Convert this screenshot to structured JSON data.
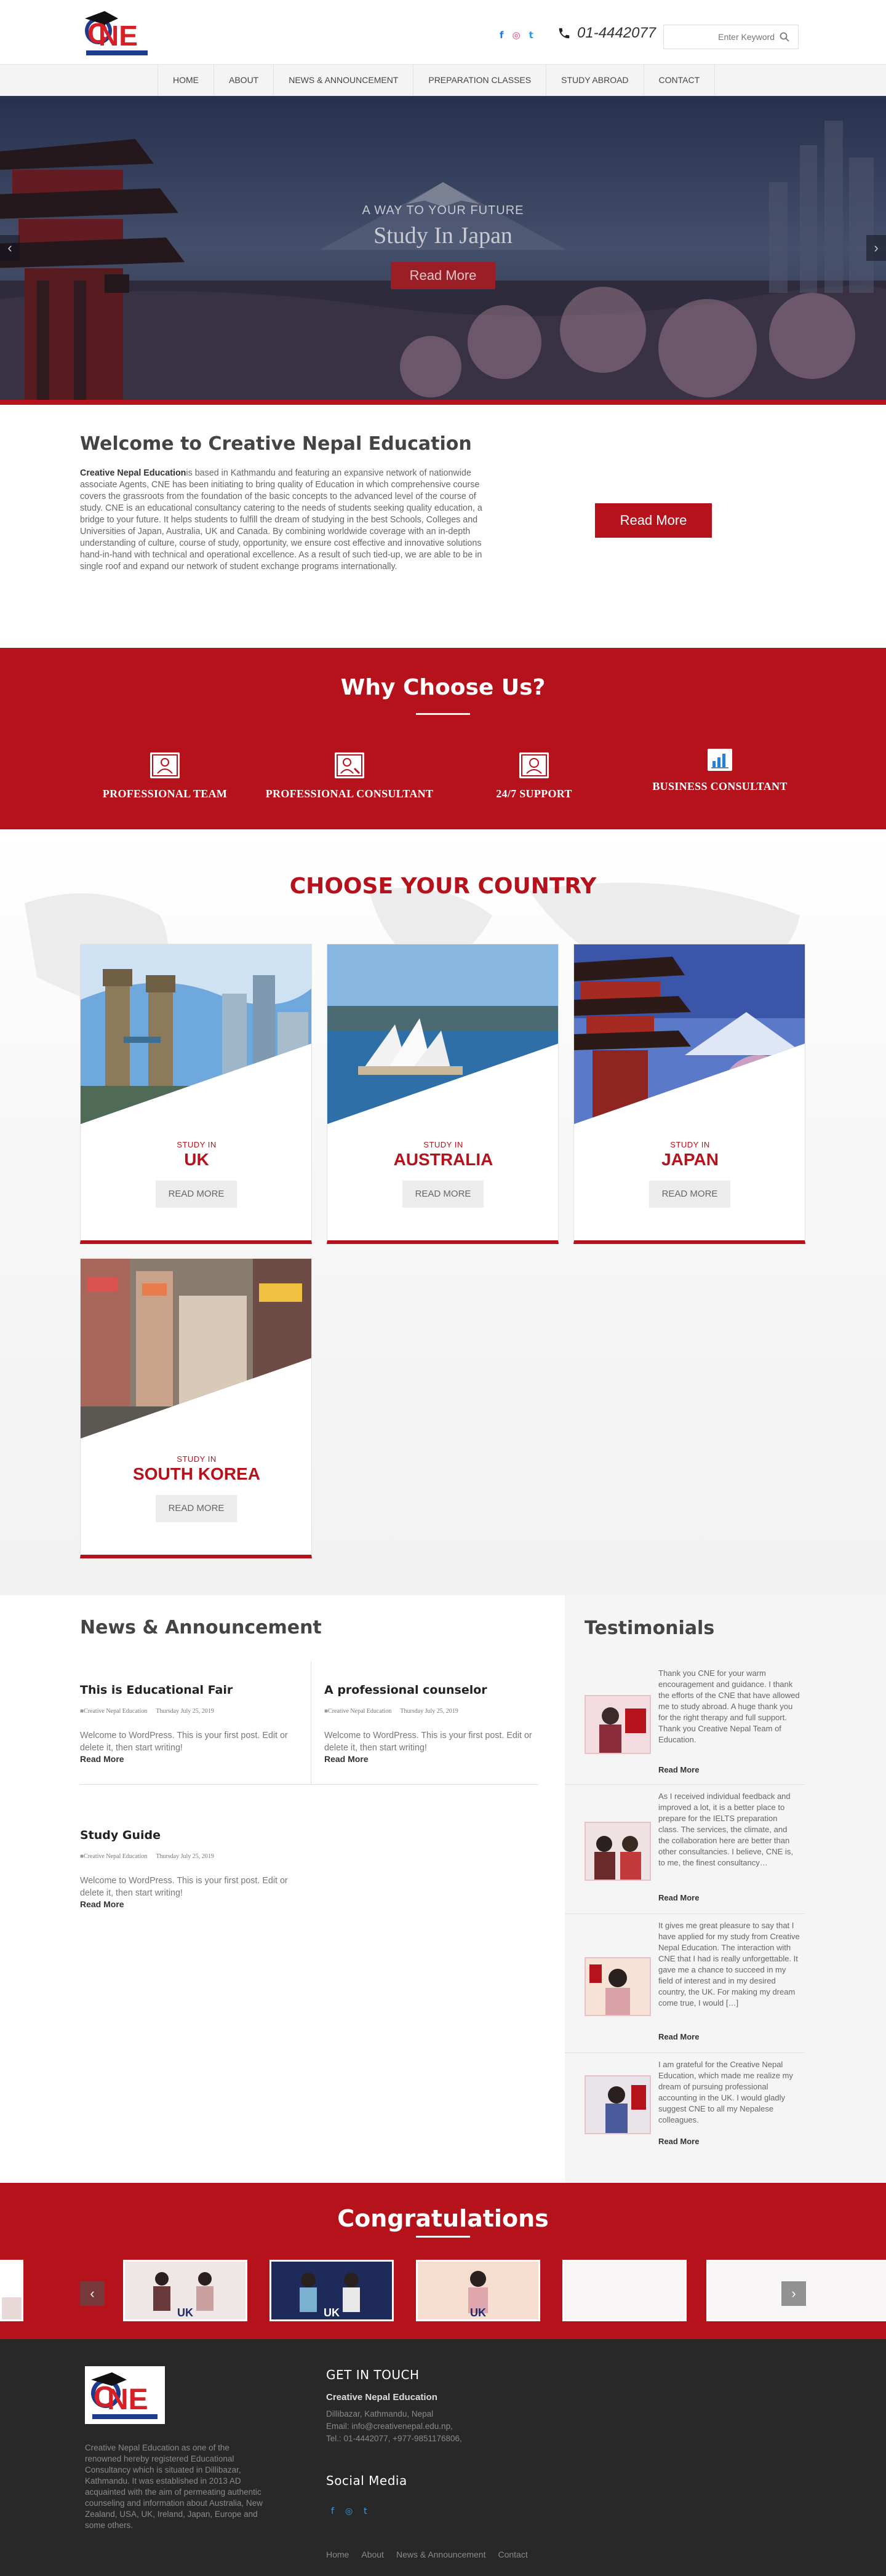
{
  "header": {
    "logo_text": "CNE",
    "phone": "01-4442077",
    "search_placeholder": "Enter Keyword",
    "social": [
      "f",
      "◎",
      "t"
    ]
  },
  "nav": {
    "items": [
      "Home",
      "About",
      "News & Announcement",
      "Preparation Classes",
      "Study Abroad",
      "Contact"
    ]
  },
  "hero": {
    "subtitle": "A WAY TO YOUR FUTURE",
    "title": "Study In Japan",
    "button": "Read More",
    "prev": "‹",
    "next": "›"
  },
  "welcome": {
    "title": "Welcome to Creative Nepal Education",
    "brand": "Creative Nepal Education",
    "text": "is based in Kathmandu and featuring an expansive network of nationwide associate Agents, CNE has been initiating to bring quality of Education in which comprehensive course covers the grassroots from the foundation of the basic concepts to the advanced level of the course of study. CNE is an educational consultancy catering to the needs of students seeking quality education, a bridge to your future. It helps students to fulfill the dream of studying in the best Schools, Colleges and Universities of Japan, Australia, UK and Canada. By combining worldwide coverage with an in-depth understanding of culture, course of study, opportunity, we ensure cost effective and innovative solutions hand-in-hand with technical and operational excellence. As a result of such tied-up, we are able to be in single roof and expand our network of student exchange programs internationally.",
    "button": "Read More"
  },
  "why": {
    "title": "Why Choose Us?",
    "features": [
      "PROFESSIONAL TEAM",
      "PROFESSIONAL CONSULTANT",
      "24/7 SUPPORT",
      "BUSINESS CONSULTANT"
    ]
  },
  "countries": {
    "title": "CHOOSE YOUR COUNTRY",
    "study_label": "STUDY IN",
    "button": "READ MORE",
    "items": [
      "UK",
      "AUSTRALIA",
      "JAPAN",
      "SOUTH KOREA"
    ]
  },
  "news": {
    "title": "News & Announcement",
    "posts": [
      {
        "title": "This is Educational Fair",
        "author": "Creative Nepal Education",
        "date": "Thursday July 25, 2019",
        "excerpt": "Welcome to WordPress. This is your first post. Edit or delete it, then start writing!",
        "more": "Read More"
      },
      {
        "title": "A professional counselor",
        "author": "Creative Nepal Education",
        "date": "Thursday July 25, 2019",
        "excerpt": "Welcome to WordPress. This is your first post. Edit or delete it, then start writing!",
        "more": "Read More"
      },
      {
        "title": "Study Guide",
        "author": "Creative Nepal Education",
        "date": "Thursday July 25, 2019",
        "excerpt": "Welcome to WordPress. This is your first post. Edit or delete it, then start writing!",
        "more": "Read More"
      }
    ]
  },
  "testimonials": {
    "title": "Testimonials",
    "items": [
      {
        "text": "Thank you CNE for your warm encouragement and guidance. I thank the efforts of the CNE that have allowed me to study abroad. A huge thank you for the right therapy and full support. Thank you Creative Nepal Team of Education.",
        "more": "Read More"
      },
      {
        "text": "As I received individual feedback and improved a lot, it is a better place to prepare for the IELTS preparation class. The services, the climate, and the collaboration here are better than other consultancies. I believe, CNE is, to me, the finest consultancy…",
        "more": "Read More"
      },
      {
        "text": "It gives me great pleasure to say that I have applied for my study from Creative Nepal Education. The interaction with CNE that I had is really unforgettable. It gave me a chance to succeed in my field of interest and in my desired country, the UK. For making my dream come true, I would […]",
        "more": "Read More"
      },
      {
        "text": "I am grateful for the Creative Nepal Education, which made me realize my dream of pursuing professional accounting in the UK. I would gladly suggest CNE to all my Nepalese colleagues.",
        "more": "Read More"
      }
    ]
  },
  "congrats": {
    "title": "Congratulations",
    "slide_label": "UK",
    "prev": "‹",
    "next": "›"
  },
  "footer": {
    "about": "Creative Nepal Education as one of the renowned hereby registered Educational Consultancy which is situated in Dillibazar, Kathmandu. It was established in 2013 AD acquainted with the aim of permeating authentic counseling and information about Australia, New Zealand, USA, UK, Ireland, Japan, Europe and some others.",
    "contact_title": "GET IN TOUCH",
    "company": "Creative Nepal Education",
    "address": "Dillibazar, Kathmandu, Nepal",
    "email": "Email:   info@creativenepal.edu.np,",
    "tel": "Tel.:    01-4442077, +977-9851176806,",
    "social_title": "Social Media",
    "social": [
      "f",
      "◎",
      "t"
    ],
    "links": [
      "Home",
      "About",
      "News & Announcement",
      "Contact"
    ]
  },
  "colors": {
    "brand_red": "#b5121b",
    "footer_bg": "#282828"
  }
}
